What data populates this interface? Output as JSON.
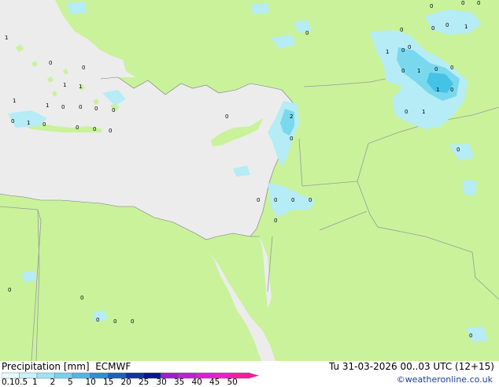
{
  "title": "Precipitation [mm]",
  "model": "ECMWF",
  "valid_time": "Tu 31-03-2026 00..03 UTC (12+15)",
  "credit": "©weatheronline.co.uk",
  "colors": {
    "land": "#c9f29b",
    "sea": "#ececec",
    "border": "#9a9a9a",
    "coast": "#7a7a7a",
    "precip_light": "#b5ecf6",
    "precip_mid": "#7ad8ee",
    "precip_heavy": "#45c3e6"
  },
  "legend": {
    "labels": [
      "0.1",
      "0.5",
      "1",
      "2",
      "5",
      "10",
      "15",
      "20",
      "25",
      "30",
      "35",
      "40",
      "45",
      "50"
    ],
    "colors": [
      "#e8fbff",
      "#c8f2fb",
      "#9fe3f4",
      "#74d3ec",
      "#4ab9e2",
      "#2f8fd2",
      "#1e5fbf",
      "#1530a8",
      "#0a1596",
      "#9a1ed2",
      "#c11ed9",
      "#e01ed6",
      "#f21ec0",
      "#f51e9a"
    ]
  },
  "point_values": [
    "1",
    "0",
    "1",
    "0",
    "1",
    "1",
    "0",
    "0",
    "0",
    "1",
    "0",
    "0",
    "0",
    "1",
    "0",
    "0",
    "0",
    "0",
    "2",
    "0",
    "0",
    "0",
    "0",
    "0",
    "0",
    "0",
    "0",
    "0",
    "0",
    "0",
    "0",
    "0",
    "1",
    "0",
    "0",
    "1",
    "0",
    "1",
    "0",
    "0",
    "0",
    "0",
    "1",
    "0",
    "1",
    "0",
    "0",
    "0",
    "0",
    "0",
    "0"
  ]
}
